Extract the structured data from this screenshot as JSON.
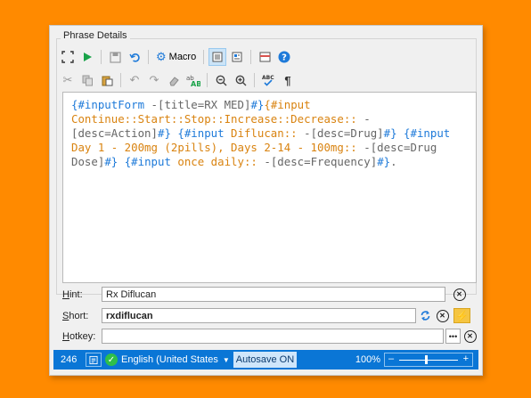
{
  "panel": {
    "title": "Phrase Details"
  },
  "toolbar": {
    "macro_label": "Macro"
  },
  "editor": {
    "segments": [
      {
        "t": "{#inputForm ",
        "c": "c-blue"
      },
      {
        "t": "-[title=RX MED]",
        "c": "c-gray"
      },
      {
        "t": "#}",
        "c": "c-blue"
      },
      {
        "t": "{#input\nContinue::Start::Stop::Increase::Decrease::",
        "c": "c-orange"
      },
      {
        "t": " -\n[desc=Action]",
        "c": "c-gray"
      },
      {
        "t": "#}",
        "c": "c-blue"
      },
      {
        "t": " {#input ",
        "c": "c-blue"
      },
      {
        "t": "Diflucan::",
        "c": "c-orange"
      },
      {
        "t": " -[desc=Drug]",
        "c": "c-gray"
      },
      {
        "t": "#}",
        "c": "c-blue"
      },
      {
        "t": " {#input\n",
        "c": "c-blue"
      },
      {
        "t": "Day 1 - 200mg (2pills), Days 2-14 - 100mg::",
        "c": "c-orange"
      },
      {
        "t": " -[desc=Drug\nDose]",
        "c": "c-gray"
      },
      {
        "t": "#}",
        "c": "c-blue"
      },
      {
        "t": " {#input ",
        "c": "c-blue"
      },
      {
        "t": "once daily::",
        "c": "c-orange"
      },
      {
        "t": " -[desc=Frequency]",
        "c": "c-gray"
      },
      {
        "t": "#}",
        "c": "c-blue"
      },
      {
        "t": ".",
        "c": "c-gray"
      }
    ]
  },
  "fields": {
    "hint_label": "Hint:",
    "hint_value": "Rx Diflucan",
    "short_label": "Short:",
    "short_value": "rxdiflucan",
    "hotkey_label": "Hotkey:",
    "hotkey_value": ""
  },
  "status": {
    "char_count": "246",
    "language": "English (United States",
    "autosave": "Autosave ON",
    "zoom": "100%"
  },
  "colors": {
    "background": "#ff8a00",
    "status_bar": "#0a76d6",
    "tag_blue": "#1e7ad9",
    "value_orange": "#d98310"
  }
}
